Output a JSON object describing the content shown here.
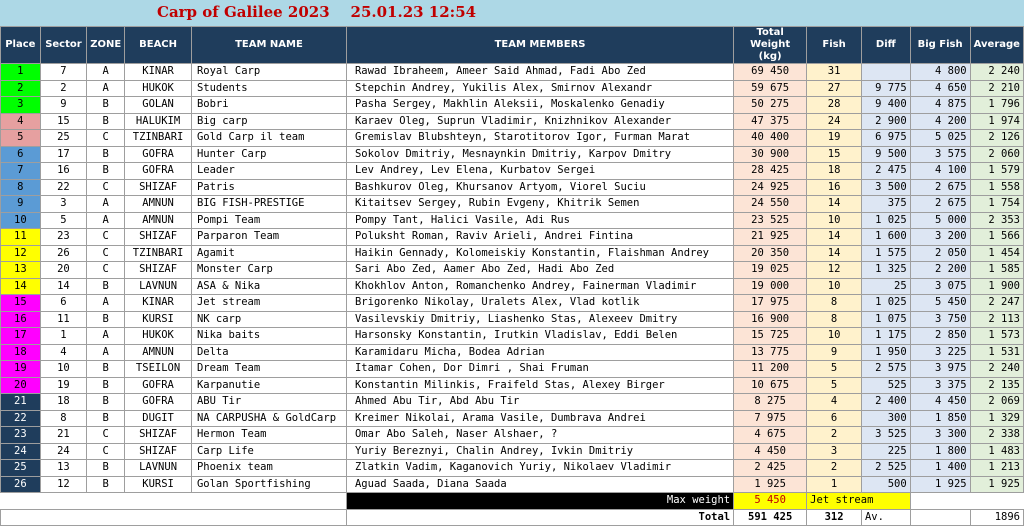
{
  "title": "Carp of Galilee 2023    25.01.23 12:54",
  "colors": {
    "title_bar": "#add8e6",
    "header_bg": "#1f3d5c",
    "place_bgs": [
      "#00ff00",
      "#00ff00",
      "#00ff00",
      "#e6a0a0",
      "#e6a0a0",
      "#5b9bd5",
      "#5b9bd5",
      "#5b9bd5",
      "#5b9bd5",
      "#5b9bd5",
      "#ffff00",
      "#ffff00",
      "#ffff00",
      "#ffff00",
      "#ff00ff",
      "#ff00ff",
      "#ff00ff",
      "#ff00ff",
      "#ff00ff",
      "#ff00ff",
      "#1f3d5c",
      "#1f3d5c",
      "#1f3d5c",
      "#1f3d5c",
      "#1f3d5c",
      "#1f3d5c"
    ]
  },
  "headers": {
    "place": "Place",
    "sector": "Sector",
    "zone": "ZONE",
    "beach": "BEACH",
    "team_name": "TEAM NAME",
    "team_members": "TEAM MEMBERS",
    "total_weight": "Total Weight (kg)",
    "fish": "Fish",
    "diff": "Diff",
    "big_fish": "Big Fish",
    "average": "Average"
  },
  "rows": [
    {
      "place": "1",
      "sector": "7",
      "zone": "A",
      "beach": "KINAR",
      "team": "Royal Carp",
      "members": "Rawad Ibraheem, Ameer Said Ahmad, Fadi Abo Zed",
      "total": "69 450",
      "fish": "31",
      "diff": "",
      "big": "4 800",
      "avg": "2 240"
    },
    {
      "place": "2",
      "sector": "2",
      "zone": "A",
      "beach": "HUKOK",
      "team": "Students",
      "members": "Stepchin Andrey, Yukilis Alex, Smirnov Alexandr",
      "total": "59 675",
      "fish": "27",
      "diff": "9 775",
      "big": "4 650",
      "avg": "2 210"
    },
    {
      "place": "3",
      "sector": "9",
      "zone": "B",
      "beach": "GOLAN",
      "team": "Bobri",
      "members": "Pasha Sergey, Makhlin Aleksii, Moskalenko Genadiy",
      "total": "50 275",
      "fish": "28",
      "diff": "9 400",
      "big": "4 875",
      "avg": "1 796"
    },
    {
      "place": "4",
      "sector": "15",
      "zone": "B",
      "beach": "HALUKIM",
      "team": "Big carp",
      "members": "Karaev Oleg, Suprun Vladimir, Knizhnikov Alexander",
      "total": "47 375",
      "fish": "24",
      "diff": "2 900",
      "big": "4 200",
      "avg": "1 974"
    },
    {
      "place": "5",
      "sector": "25",
      "zone": "C",
      "beach": "TZINBARI",
      "team": "Gold Carp il team",
      "members": "Gremislav Blubshteyn, Starotitorov Igor, Furman Marat",
      "total": "40 400",
      "fish": "19",
      "diff": "6 975",
      "big": "5 025",
      "avg": "2 126"
    },
    {
      "place": "6",
      "sector": "17",
      "zone": "B",
      "beach": "GOFRA",
      "team": "Hunter Carp",
      "members": "Sokolov Dmitriy, Mesnaynkin Dmitriy, Karpov Dmitry",
      "total": "30 900",
      "fish": "15",
      "diff": "9 500",
      "big": "3 575",
      "avg": "2 060"
    },
    {
      "place": "7",
      "sector": "16",
      "zone": "B",
      "beach": "GOFRA",
      "team": "Leader",
      "members": "Lev Andrey, Lev Elena, Kurbatov Sergei",
      "total": "28 425",
      "fish": "18",
      "diff": "2 475",
      "big": "4 100",
      "avg": "1 579"
    },
    {
      "place": "8",
      "sector": "22",
      "zone": "C",
      "beach": "SHIZAF",
      "team": "Patris",
      "members": "Bashkurov Oleg, Khursanov Artyom, Viorel Suciu",
      "total": "24 925",
      "fish": "16",
      "diff": "3 500",
      "big": "2 675",
      "avg": "1 558"
    },
    {
      "place": "9",
      "sector": "3",
      "zone": "A",
      "beach": "AMNUN",
      "team": "BIG FISH-PRESTIGE",
      "members": "Kitaitsev Sergey, Rubin Evgeny, Khitrik Semen",
      "total": "24 550",
      "fish": "14",
      "diff": "375",
      "big": "2 675",
      "avg": "1 754"
    },
    {
      "place": "10",
      "sector": "5",
      "zone": "A",
      "beach": "AMNUN",
      "team": "Pompi Team",
      "members": "Pompy Tant, Halici Vasile, Adi Rus",
      "total": "23 525",
      "fish": "10",
      "diff": "1 025",
      "big": "5 000",
      "avg": "2 353"
    },
    {
      "place": "11",
      "sector": "23",
      "zone": "C",
      "beach": "SHIZAF",
      "team": "Parparon Team",
      "members": "Poluksht Roman, Raviv Arieli, Andrei Fintina",
      "total": "21 925",
      "fish": "14",
      "diff": "1 600",
      "big": "3 200",
      "avg": "1 566"
    },
    {
      "place": "12",
      "sector": "26",
      "zone": "C",
      "beach": "TZINBARI",
      "team": "Agamit",
      "members": "Haikin Gennady, Kolomeiskiy Konstantin, Flaishman Andrey",
      "total": "20 350",
      "fish": "14",
      "diff": "1 575",
      "big": "2 050",
      "avg": "1 454"
    },
    {
      "place": "13",
      "sector": "20",
      "zone": "C",
      "beach": "SHIZAF",
      "team": "Monster Carp",
      "members": "Sari Abo Zed, Aamer Abo Zed, Hadi Abo Zed",
      "total": "19 025",
      "fish": "12",
      "diff": "1 325",
      "big": "2 200",
      "avg": "1 585"
    },
    {
      "place": "14",
      "sector": "14",
      "zone": "B",
      "beach": "LAVNUN",
      "team": "ASA & Nika",
      "members": "Khokhlov Anton, Romanchenko Andrey, Fainerman Vladimir",
      "total": "19 000",
      "fish": "10",
      "diff": "25",
      "big": "3 075",
      "avg": "1 900"
    },
    {
      "place": "15",
      "sector": "6",
      "zone": "A",
      "beach": "KINAR",
      "team": "Jet stream",
      "members": "Brigorenko Nikolay, Uralets Alex, Vlad kotlik",
      "total": "17 975",
      "fish": "8",
      "diff": "1 025",
      "big": "5 450",
      "avg": "2 247"
    },
    {
      "place": "16",
      "sector": "11",
      "zone": "B",
      "beach": "KURSI",
      "team": "NK carp",
      "members": "Vasilevskiy Dmitriy, Liashenko Stas, Alexeev Dmitry",
      "total": "16 900",
      "fish": "8",
      "diff": "1 075",
      "big": "3 750",
      "avg": "2 113"
    },
    {
      "place": "17",
      "sector": "1",
      "zone": "A",
      "beach": "HUKOK",
      "team": "Nika baits",
      "members": "Harsonsky Konstantin, Irutkin Vladislav, Eddi Belen",
      "total": "15 725",
      "fish": "10",
      "diff": "1 175",
      "big": "2 850",
      "avg": "1 573"
    },
    {
      "place": "18",
      "sector": "4",
      "zone": "A",
      "beach": "AMNUN",
      "team": "Delta",
      "members": "Karamidaru Micha, Bodea Adrian",
      "total": "13 775",
      "fish": "9",
      "diff": "1 950",
      "big": "3 225",
      "avg": "1 531"
    },
    {
      "place": "19",
      "sector": "10",
      "zone": "B",
      "beach": "TSEILON",
      "team": "Dream Team",
      "members": "Itamar Cohen, Dor Dimri , Shai Fruman",
      "total": "11 200",
      "fish": "5",
      "diff": "2 575",
      "big": "3 975",
      "avg": "2 240"
    },
    {
      "place": "20",
      "sector": "19",
      "zone": "B",
      "beach": "GOFRA",
      "team": "Karpanutie",
      "members": "Konstantin Milinkis, Fraifeld Stas, Alexey Birger",
      "total": "10 675",
      "fish": "5",
      "diff": "525",
      "big": "3 375",
      "avg": "2 135"
    },
    {
      "place": "21",
      "sector": "18",
      "zone": "B",
      "beach": "GOFRA",
      "team": "ABU Tir",
      "members": "Ahmed Abu Tir, Abd Abu Tir",
      "total": "8 275",
      "fish": "4",
      "diff": "2 400",
      "big": "4 450",
      "avg": "2 069"
    },
    {
      "place": "22",
      "sector": "8",
      "zone": "B",
      "beach": "DUGIT",
      "team": "NA CARPUSHA & GoldCarp",
      "members": "Kreimer Nikolai, Arama Vasile, Dumbrava Andrei",
      "total": "7 975",
      "fish": "6",
      "diff": "300",
      "big": "1 850",
      "avg": "1 329"
    },
    {
      "place": "23",
      "sector": "21",
      "zone": "C",
      "beach": "SHIZAF",
      "team": "Hermon Team",
      "members": "Omar Abo Saleh, Naser Alshaer, ?",
      "total": "4 675",
      "fish": "2",
      "diff": "3 525",
      "big": "3 300",
      "avg": "2 338"
    },
    {
      "place": "24",
      "sector": "24",
      "zone": "C",
      "beach": "SHIZAF",
      "team": "Carp Life",
      "members": "Yuriy Bereznyi, Chalin Andrey, Ivkin Dmitriy",
      "total": "4 450",
      "fish": "3",
      "diff": "225",
      "big": "1 800",
      "avg": "1 483"
    },
    {
      "place": "25",
      "sector": "13",
      "zone": "B",
      "beach": "LAVNUN",
      "team": "Phoenix team",
      "members": "Zlatkin Vadim, Kaganovich Yuriy, Nikolaev Vladimir",
      "total": "2 425",
      "fish": "2",
      "diff": "2 525",
      "big": "1 400",
      "avg": "1 213"
    },
    {
      "place": "26",
      "sector": "12",
      "zone": "B",
      "beach": "KURSI",
      "team": "Golan Sportfishing",
      "members": "Aguad Saada, Diana Saada",
      "total": "1 925",
      "fish": "1",
      "diff": "500",
      "big": "1 925",
      "avg": "1 925"
    }
  ],
  "summary": {
    "max_weight_label": "Max weight",
    "max_weight_value": "5 450",
    "max_weight_team": "Jet stream",
    "total_label": "Total",
    "total_weight": "591 425",
    "total_fish": "312",
    "av_label": "Av.",
    "av_value": "1896"
  }
}
